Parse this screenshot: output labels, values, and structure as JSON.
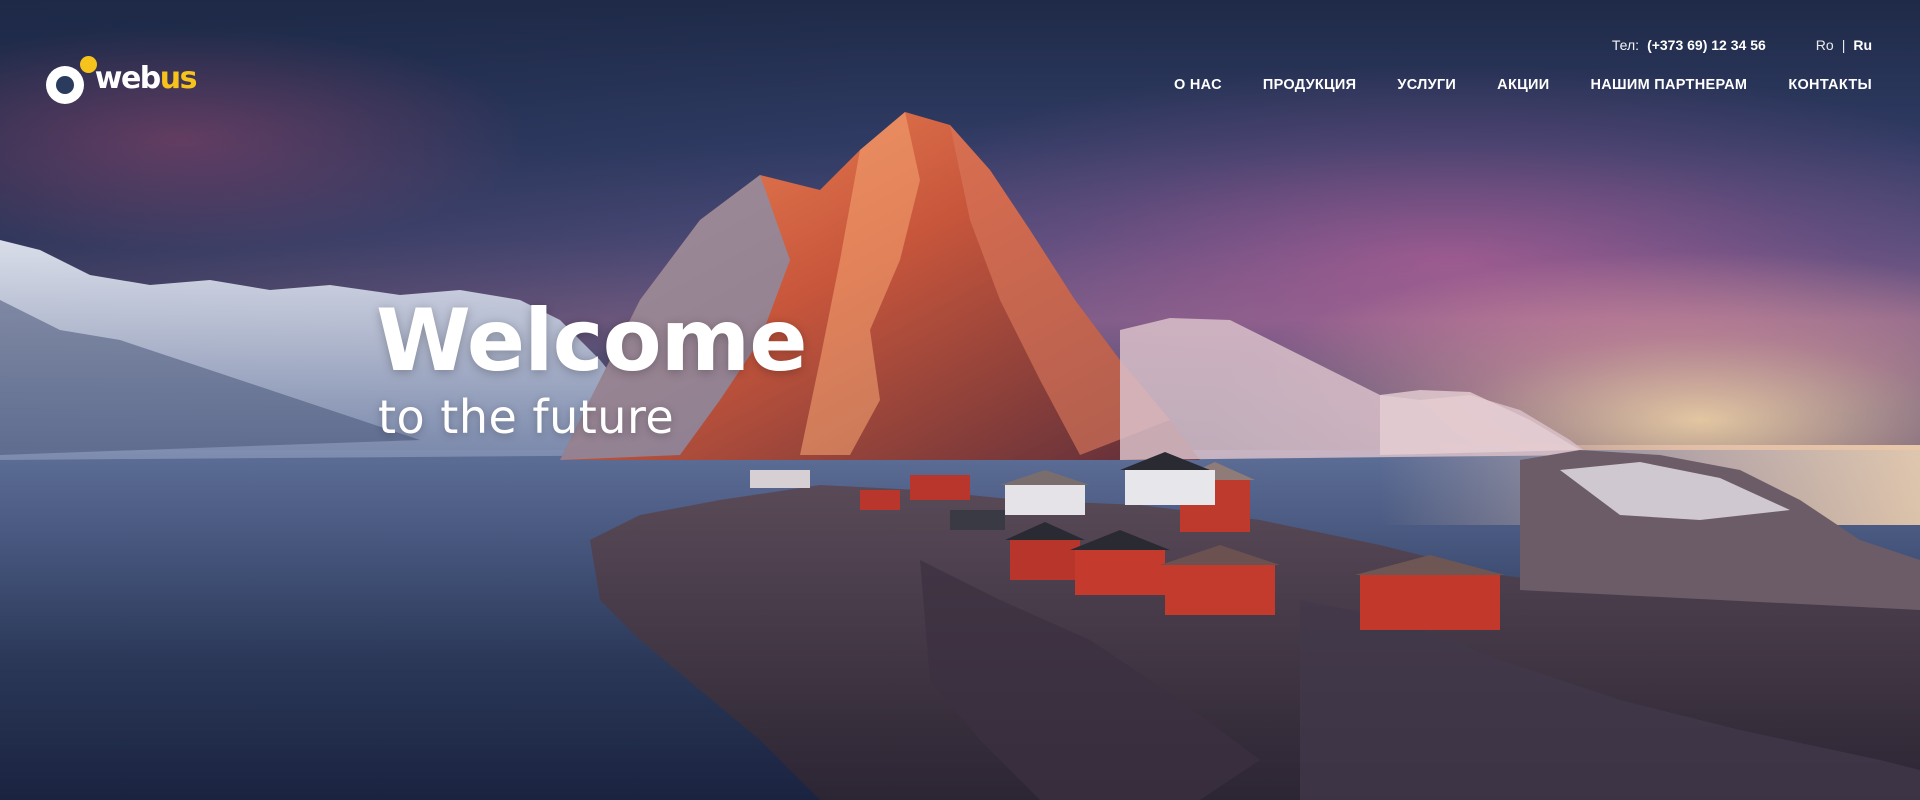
{
  "brand": {
    "logo_text_white": "web",
    "logo_text_accent": "us",
    "accent_color": "#f6c21c"
  },
  "header": {
    "phone_label": "Тел:",
    "phone_number": "(+373 69) 12 34 56",
    "languages": [
      "Ro",
      "Ru"
    ],
    "language_separator": "|",
    "active_language": "Ru"
  },
  "nav": {
    "items": [
      "О НАС",
      "ПРОДУКЦИЯ",
      "УСЛУГИ",
      "АКЦИИ",
      "НАШИМ ПАРТНЕРАМ",
      "КОНТАКТЫ"
    ]
  },
  "hero": {
    "title": "Welcome",
    "subtitle": "to the future",
    "icon": "hero-landscape"
  }
}
